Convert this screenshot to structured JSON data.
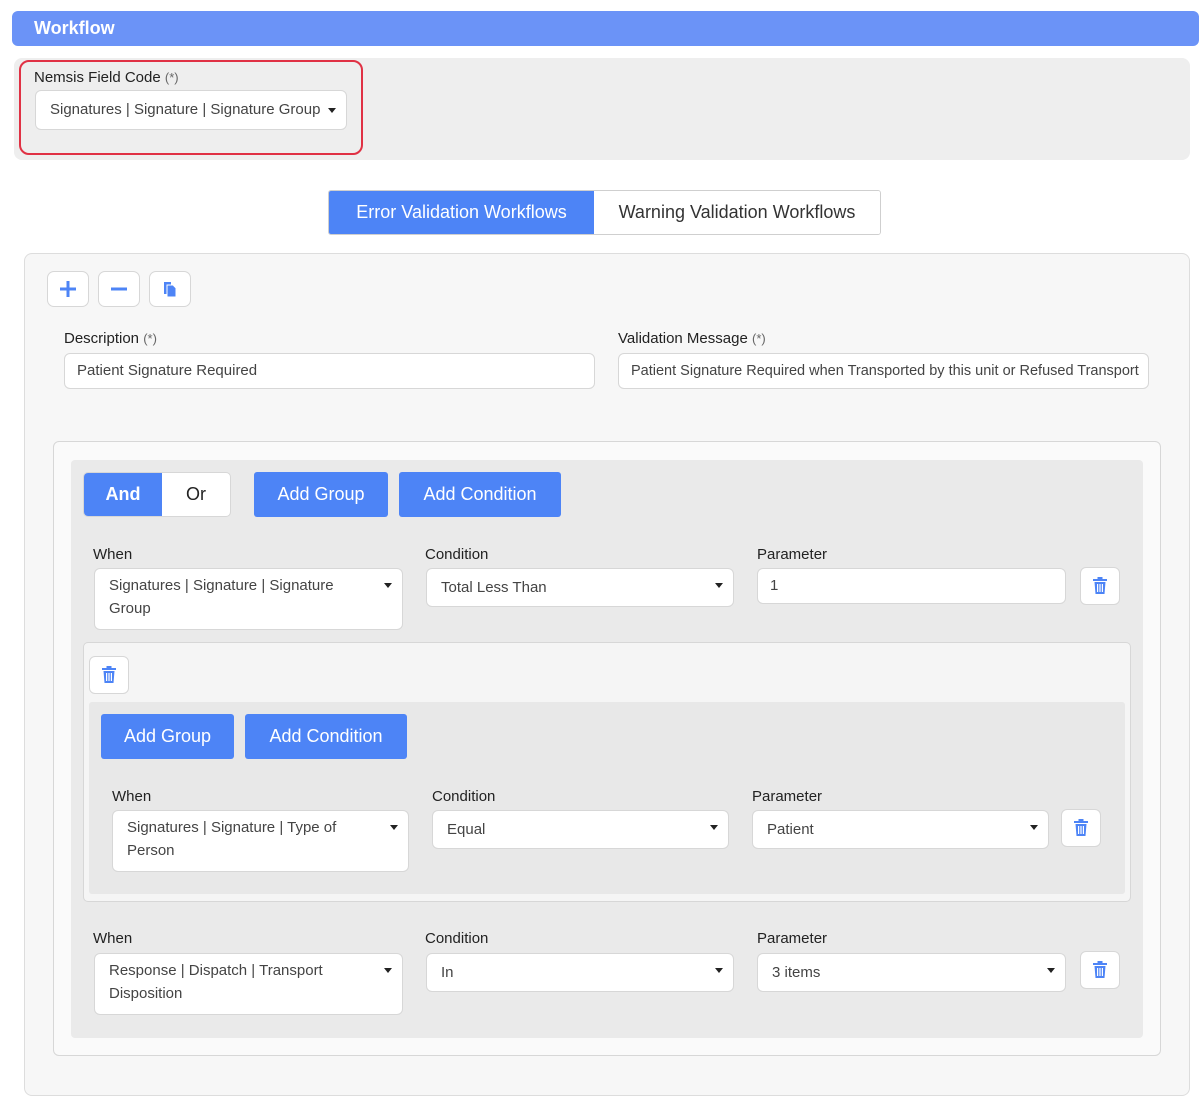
{
  "header": {
    "title": "Workflow"
  },
  "field_code": {
    "label": "Nemsis Field Code",
    "required_mark": "(*)",
    "value": "Signatures | Signature | Signature Group"
  },
  "tabs": [
    {
      "label": "Error Validation Workflows",
      "active": true
    },
    {
      "label": "Warning Validation Workflows",
      "active": false
    }
  ],
  "toolbar": {
    "icons": [
      "plus-icon",
      "minus-icon",
      "copy-icon"
    ]
  },
  "description": {
    "label": "Description",
    "required_mark": "(*)",
    "value": "Patient Signature Required"
  },
  "validation_message": {
    "label": "Validation Message",
    "required_mark": "(*)",
    "value": "Patient Signature Required when Transported by this unit or Refused Transport"
  },
  "logic": {
    "and_label": "And",
    "or_label": "Or",
    "selected": "And"
  },
  "buttons": {
    "add_group": "Add Group",
    "add_condition": "Add Condition"
  },
  "column_labels": {
    "when": "When",
    "condition": "Condition",
    "parameter": "Parameter"
  },
  "rows": [
    {
      "when": "Signatures | Signature | Signature Group",
      "condition": "Total Less Than",
      "parameter": "1"
    },
    {
      "when": "Response | Dispatch | Transport Disposition",
      "condition": "In",
      "parameter": "3 items"
    }
  ],
  "subgroup": {
    "rows": [
      {
        "when": "Signatures | Signature | Type of Person",
        "condition": "Equal",
        "parameter": "Patient"
      }
    ]
  },
  "colors": {
    "header": "#6b93f7",
    "primary": "#4d84f6",
    "highlight": "#e03144"
  }
}
